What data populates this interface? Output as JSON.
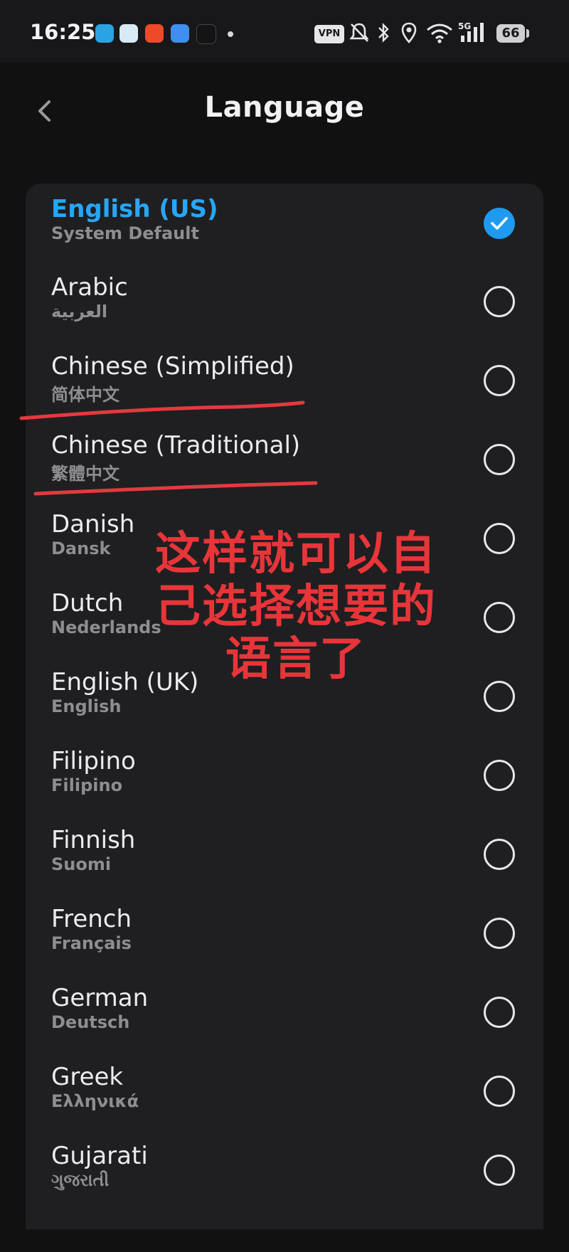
{
  "status_bar": {
    "time": "16:25",
    "vpn_label": "VPN",
    "network_label": "5G",
    "battery_level": "66"
  },
  "header": {
    "title": "Language",
    "back_icon": "chevron-left-icon"
  },
  "languages": [
    {
      "name": "English (US)",
      "native": "System Default",
      "selected": true
    },
    {
      "name": "Arabic",
      "native": "العربية",
      "selected": false
    },
    {
      "name": "Chinese (Simplified)",
      "native": "简体中文",
      "selected": false
    },
    {
      "name": "Chinese (Traditional)",
      "native": "繁體中文",
      "selected": false
    },
    {
      "name": "Danish",
      "native": "Dansk",
      "selected": false
    },
    {
      "name": "Dutch",
      "native": "Nederlands",
      "selected": false
    },
    {
      "name": "English (UK)",
      "native": "English",
      "selected": false
    },
    {
      "name": "Filipino",
      "native": "Filipino",
      "selected": false
    },
    {
      "name": "Finnish",
      "native": "Suomi",
      "selected": false
    },
    {
      "name": "French",
      "native": "Français",
      "selected": false
    },
    {
      "name": "German",
      "native": "Deutsch",
      "selected": false
    },
    {
      "name": "Greek",
      "native": "Ελληνικά",
      "selected": false
    },
    {
      "name": "Gujarati",
      "native": "ગુજરાતી",
      "selected": false
    }
  ],
  "annotation": {
    "line1": "这样就可以自",
    "line2": "己选择想要的",
    "line3": "语言了",
    "color": "#e8353a"
  },
  "colors": {
    "accent": "#1e9bf0",
    "selected_text": "#28a6f5",
    "background": "#111112",
    "card": "#1f1f21"
  }
}
